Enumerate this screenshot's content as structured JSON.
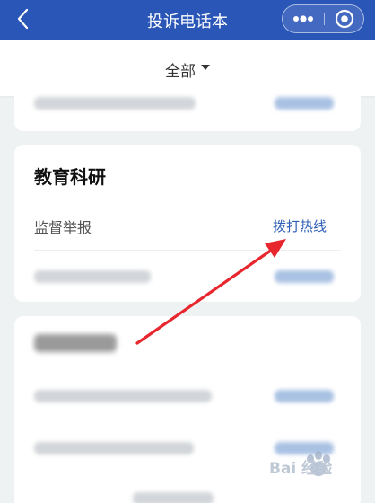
{
  "navbar": {
    "title": "投诉电话本",
    "back_icon": "chevron-left-icon",
    "more_icon": "more-dots-icon",
    "close_icon": "target-close-icon",
    "color": "#2a56b8"
  },
  "filter": {
    "label": "全部",
    "caret_icon": "caret-down-icon"
  },
  "education_card": {
    "title": "教育科研",
    "rows": [
      {
        "label": "监督举报",
        "action": "拨打热线"
      }
    ]
  },
  "colors": {
    "link": "#2e5fb7",
    "background": "#eef2f3",
    "annotation_arrow": "#e8262d"
  },
  "watermark": {
    "text": "Bai 经验",
    "logo_icon": "paw-icon"
  }
}
